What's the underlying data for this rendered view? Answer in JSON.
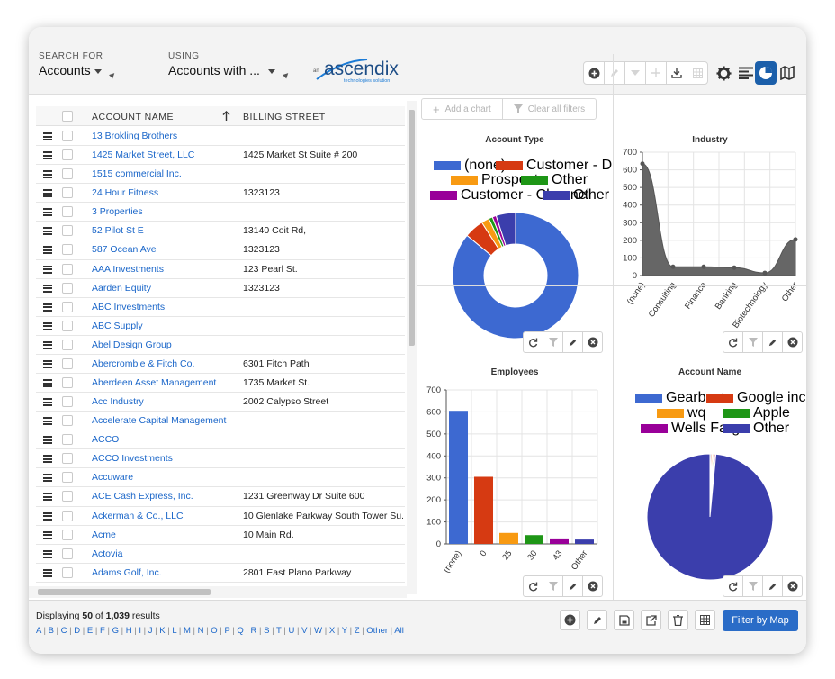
{
  "header": {
    "search_label": "SEARCH FOR",
    "search_value": "Accounts",
    "using_label": "USING",
    "using_value": "Accounts with ...",
    "logo": {
      "small": "an",
      "brand": "ascendix",
      "tagline": "technologies solution"
    }
  },
  "list": {
    "columns": {
      "name": "ACCOUNT NAME",
      "street": "BILLING STREET"
    },
    "rows": [
      {
        "name": "13 Brokling Brothers",
        "street": ""
      },
      {
        "name": "1425 Market Street, LLC",
        "street": "1425 Market St Suite # 200"
      },
      {
        "name": "1515 commercial Inc.",
        "street": ""
      },
      {
        "name": "24 Hour Fitness",
        "street": "1323123"
      },
      {
        "name": "3 Properties",
        "street": ""
      },
      {
        "name": "52 Pilot St E",
        "street": "13140 Coit Rd,"
      },
      {
        "name": "587 Ocean Ave",
        "street": "1323123"
      },
      {
        "name": "AAA Investments",
        "street": "123 Pearl St."
      },
      {
        "name": "Aarden Equity",
        "street": "1323123"
      },
      {
        "name": "ABC Investments",
        "street": ""
      },
      {
        "name": "ABC Supply",
        "street": ""
      },
      {
        "name": "Abel Design Group",
        "street": ""
      },
      {
        "name": "Abercrombie & Fitch Co.",
        "street": "6301 Fitch Path"
      },
      {
        "name": "Aberdeen Asset Management",
        "street": "1735 Market St."
      },
      {
        "name": "Acc Industry",
        "street": "2002 Calypso Street"
      },
      {
        "name": "Accelerate Capital Management",
        "street": ""
      },
      {
        "name": "ACCO",
        "street": ""
      },
      {
        "name": "ACCO Investments",
        "street": ""
      },
      {
        "name": "Accuware",
        "street": ""
      },
      {
        "name": "ACE Cash Express, Inc.",
        "street": "1231 Greenway Dr Suite 600"
      },
      {
        "name": "Ackerman & Co., LLC",
        "street": "10 Glenlake Parkway South Tower Su..."
      },
      {
        "name": "Acme",
        "street": "10 Main Rd."
      },
      {
        "name": "Actovia",
        "street": ""
      },
      {
        "name": "Adams Golf, Inc.",
        "street": "2801 East Plano Parkway"
      }
    ]
  },
  "chart_toolbar": {
    "add": "Add a chart",
    "clear": "Clear all filters"
  },
  "chart_data": [
    {
      "type": "pie",
      "title": "Account Type",
      "legend": [
        "(none)",
        "Customer - Direct",
        "Prospect",
        "Other",
        "Customer - Channel",
        "Other"
      ],
      "colors": [
        "#3d69d1",
        "#d63a12",
        "#f89a12",
        "#1e9616",
        "#990099",
        "#3b3eac"
      ],
      "values": [
        86,
        5,
        2,
        1,
        1,
        5
      ]
    },
    {
      "type": "area",
      "title": "Industry",
      "categories": [
        "(none)",
        "Consulting",
        "Finance",
        "Banking",
        "Biotechnology",
        "Other"
      ],
      "values": [
        635,
        50,
        50,
        45,
        15,
        205
      ],
      "ylim": [
        0,
        700
      ],
      "yticks": [
        "0",
        "100",
        "200",
        "300",
        "400",
        "500",
        "600",
        "700"
      ]
    },
    {
      "type": "bar",
      "title": "Employees",
      "categories": [
        "(none)",
        "0",
        "25",
        "30",
        "43",
        "Other"
      ],
      "values": [
        605,
        305,
        50,
        40,
        25,
        20
      ],
      "colors": [
        "#3d69d1",
        "#d63a12",
        "#f89a12",
        "#1e9616",
        "#990099",
        "#3b3eac"
      ],
      "ylim": [
        0,
        700
      ],
      "yticks": [
        "0",
        "100",
        "200",
        "300",
        "400",
        "500",
        "600",
        "700"
      ]
    },
    {
      "type": "pie",
      "title": "Account Name",
      "legend": [
        "Gearbest",
        "Google inc.",
        "wq",
        "Apple",
        "Wells Fargo",
        "Other"
      ],
      "colors": [
        "#3d69d1",
        "#d63a12",
        "#f89a12",
        "#1e9616",
        "#990099",
        "#3b3eac"
      ],
      "values": [
        0.3,
        0.3,
        0.3,
        0.3,
        0.3,
        98.5
      ]
    }
  ],
  "footer": {
    "displaying_prefix": "Displaying ",
    "shown": "50",
    "of_text": " of ",
    "total": "1,039",
    "suffix": " results",
    "letters": [
      "A",
      "B",
      "C",
      "D",
      "E",
      "F",
      "G",
      "H",
      "I",
      "J",
      "K",
      "L",
      "M",
      "N",
      "O",
      "P",
      "Q",
      "R",
      "S",
      "T",
      "U",
      "V",
      "W",
      "X",
      "Y",
      "Z",
      "Other",
      "All"
    ],
    "filter_button": "Filter by Map"
  }
}
